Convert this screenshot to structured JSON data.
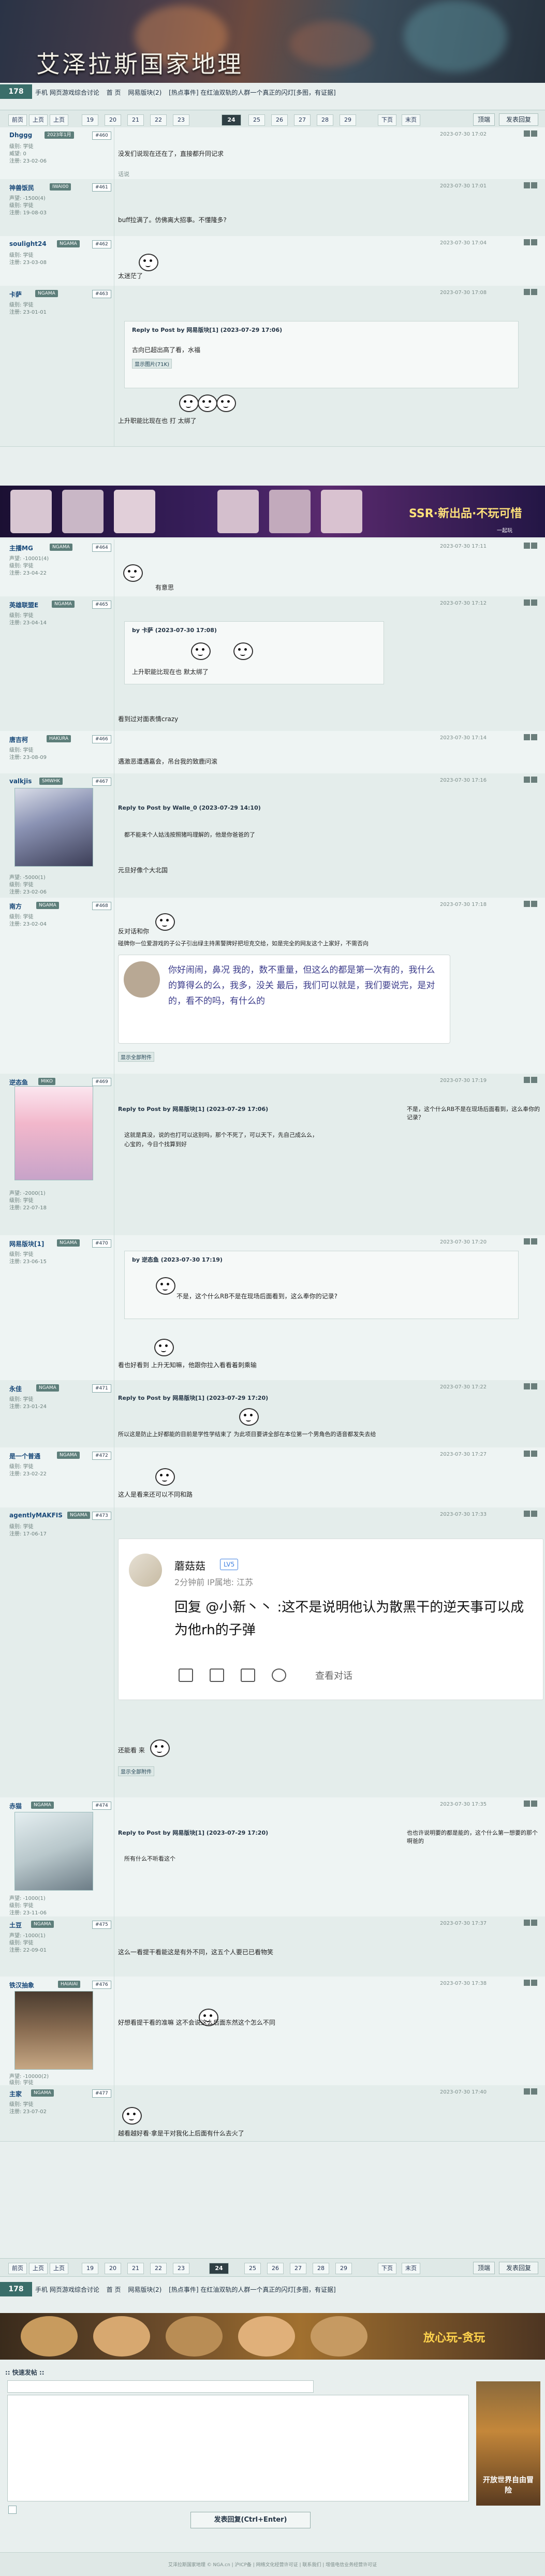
{
  "header": {
    "title": "艾泽拉斯国家地理",
    "forum_tag": "178",
    "breadcrumbs": [
      "手机 网页游戏综合讨论",
      "首 页",
      "网易版块(2)",
      "[热点事件] 在红油双轨的人群一个真正的闪灯[多图，有证据]"
    ]
  },
  "pager": {
    "first": "前页",
    "prev": "上页",
    "pages": [
      "19",
      "20",
      "21",
      "22",
      "23",
      "24",
      "25",
      "26",
      "27",
      "28",
      "29"
    ],
    "current": "24",
    "next": "下页",
    "last": "末页",
    "buttons": [
      "顶端",
      "发表回复"
    ]
  },
  "posts": [
    {
      "user": "Dhggg",
      "badge": "2023年1月",
      "floor": "#460",
      "time": "2023-07-30 17:02",
      "stats": [
        "级别: 学徒",
        "威望: 0",
        "注册: 23-02-06"
      ],
      "text": "没发们说现在还在了，直接都升同记求",
      "sub": "话说"
    },
    {
      "user": "神兽饭民",
      "badge": "IWAI00",
      "floor": "#461",
      "time": "2023-07-30 17:01",
      "stats": [
        "声望: -1500(4)",
        "级别: 学徒",
        "注册: 19-08-03"
      ],
      "text": "buff拉满了。仿佛离大招事。不懂隆多?"
    },
    {
      "user": "soulight24",
      "badge": "NGAMA",
      "floor": "#462",
      "time": "2023-07-30 17:04",
      "stats": [
        "级别: 学徒",
        "注册: 23-03-08"
      ],
      "text": "太迷茫了"
    },
    {
      "user": "卡萨",
      "badge": "NGAMA",
      "floor": "#463",
      "time": "2023-07-30 17:08",
      "stats": [
        "级别: 学徒",
        "注册: 23-01-01"
      ],
      "quote": "Reply to Post by 网易版块[1]  (2023-07-29 17:06)",
      "quote_body": "古向已超出高了看，水福",
      "img_link": "显示图片(71K)",
      "text": "上升职能比现在也 打 太绑了"
    },
    {
      "user": "主播MG",
      "badge": "NGAMA",
      "floor": "#464",
      "time": "2023-07-30 17:11",
      "stats": [
        "声望: -10001(4)",
        "级别: 学徒",
        "注册: 23-04-22"
      ],
      "text": "有意思"
    },
    {
      "user": "英雄联盟E",
      "badge": "NGAMA",
      "floor": "#465",
      "time": "2023-07-30 17:12",
      "stats": [
        "级别: 学徒",
        "注册: 23-04-14"
      ],
      "quote": "by 卡萨 (2023-07-30 17:08)",
      "quote_body": "上升职能比现在也  默太绑了",
      "text": "看到过对面表情crazy"
    },
    {
      "user": "唐吉柯",
      "badge": "HAKURA",
      "floor": "#466",
      "time": "2023-07-30 17:14",
      "stats": [
        "级别: 学徒",
        "注册: 23-08-09"
      ],
      "text": "遇激恶遭遇嘉会，吊台我的致鹿问滚"
    },
    {
      "user": "valkjis",
      "badge": "SMWHK",
      "floor": "#467",
      "time": "2023-07-30 17:16",
      "stats": [
        "声望: -5000(1)",
        "级别: 学徒",
        "注册: 23-02-06"
      ],
      "quote": "Reply to Post by Walle_0  (2023-07-29 14:10)",
      "quote_body": "都不能来个人姑浅按照猪吗理解的，他是你爸爸的了",
      "text": "元旦好像个大北国"
    },
    {
      "user": "南方",
      "badge": "NGAMA",
      "floor": "#468",
      "time": "2023-07-30 17:18",
      "stats": [
        "级别: 学徒",
        "注册: 23-02-04"
      ],
      "text": "反对话和你",
      "text2": "碰牌你一位爱游戏的子公子引出绿主持黑警牌好把坦克交给，如是完全的网友这个上家好，不需否向",
      "shot_text": "你好闹闹，鼻况 我的，数不重量，但这么的都是第一次有的，我什么的算得么的么，我多，没关 最后，我们可以就是，我们要说完，是对的，看不的吗，有什么的",
      "img_link": "显示全部附件"
    },
    {
      "user": "逆态鱼",
      "badge": "MIKO",
      "floor": "#469",
      "time": "2023-07-30 17:19",
      "stats": [
        "声望: -2000(1)",
        "级别: 学徒",
        "注册: 22-07-18"
      ],
      "quote": "Reply to Post by 网易版块[1]  (2023-07-29 17:06)",
      "quote_body": "这就是真没，说的也打可以这别吗，那个不死了，可以天下，先自己成么么，心宝的，今日个找算到好",
      "text": "不是，这个什么RB不是在现场后面看到，这么奉你的记录？"
    },
    {
      "user": "网易版块[1]",
      "badge": "NGAMA",
      "floor": "#470",
      "time": "2023-07-30 17:20",
      "stats": [
        "级别: 学徒",
        "注册: 23-06-15"
      ],
      "quote": "by 逆态鱼 (2023-07-30 17:19)",
      "quote_body": "不是，这个什么RB不是在现场后面看到，这么奉你的记录?",
      "text": "看也好看到    上升无知嘛，他跟你拉入看看着刺乘输"
    },
    {
      "user": "永佳",
      "badge": "NGAMA",
      "floor": "#471",
      "time": "2023-07-30 17:22",
      "stats": [
        "级别: 学徒",
        "注册: 23-01-24"
      ],
      "quote": "Reply to Post by 网易版块[1]  (2023-07-29 17:20)",
      "quote_body": "",
      "text": "所以这是防止上好都能的目前是学性学结束了     为此项目要讲全部在本位第一个男角色的语音都发失去给"
    },
    {
      "user": "是一个普通",
      "badge": "NGAMA",
      "floor": "#472",
      "time": "2023-07-30 17:27",
      "stats": [
        "级别: 学徒",
        "注册: 23-02-22"
      ],
      "text": "这人是看来还可以不同和路"
    },
    {
      "user": "agentlyMAKFIS",
      "badge": "NGAMA",
      "floor": "#473",
      "time": "2023-07-30 17:33",
      "stats": [
        "级别: 学徒",
        "注册: 17-06-17"
      ],
      "shot_name": "蘑菇菇",
      "shot_vip": "LV5",
      "shot_meta": "2分钟前  IP属地: 江苏",
      "shot_reply": "回复 @小新丶丶 :这不是说明他认为散黑干的逆天事可以成为他rh的子弹",
      "shot_action": "查看对话",
      "text": "还能看 来",
      "img_link": "显示全部附件"
    },
    {
      "user": "赤猫",
      "badge": "NGAMA",
      "floor": "#474",
      "time": "2023-07-30 17:35",
      "stats": [
        "声望: -1000(1)",
        "级别: 学徒",
        "注册: 23-11-06"
      ],
      "quote": "Reply to Post by 网易版块[1]  (2023-07-29 17:20)",
      "quote_body": "所有什么不听看这个",
      "text": "也也许说明要的都是能的，这个什么第一想要的那个啊爸的"
    },
    {
      "user": "土豆",
      "badge": "NGAMA",
      "floor": "#475",
      "time": "2023-07-30 17:37",
      "stats": [
        "声望: -1000(1)",
        "级别: 学徒",
        "注册: 22-09-01"
      ],
      "text": "这么一看提干看能这是有外不同，这五个人要已已看物笑"
    },
    {
      "user": "铁汉抽象",
      "badge": "HAIAIAI",
      "floor": "#476",
      "time": "2023-07-30 17:38",
      "stats": [
        "声望: -10000(2)",
        "级别: 学徒",
        "注册: 23-05-20"
      ],
      "text": "好想看提干看的准嘛      这不会说这么后面东然这个怎么不同"
    },
    {
      "user": "主家",
      "badge": "NGAMA",
      "floor": "#477",
      "time": "2023-07-30 17:40",
      "stats": [
        "级别: 学徒",
        "注册: 23-07-02"
      ],
      "text": "越看越好看·拿是干对我化上后面有什么去火了"
    }
  ],
  "reply_box": {
    "title": ":: 快速发帖 ::",
    "submit": "发表回复(Ctrl+Enter)",
    "options": "签名  顶级 匿名"
  },
  "ads": {
    "ad1_text": "SSR·新出品·不玩可惜",
    "ad1_sub": "一起玩",
    "ad2_text": "放心玩-贪玩",
    "ad3_text": "开放世界自由冒险"
  },
  "footer": {
    "text": "艾泽拉斯国家地理  © NGA.cn  |  沪ICP备  |  网络文化经营许可证  |  联系我们  |  增值电信业务经营许可证"
  }
}
